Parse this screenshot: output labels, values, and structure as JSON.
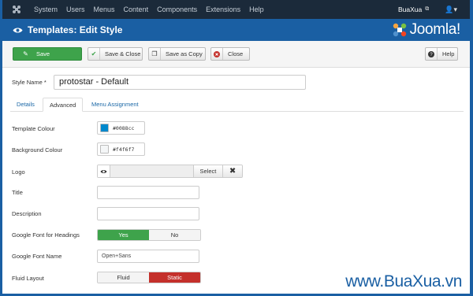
{
  "topbar": {
    "menu": [
      "System",
      "Users",
      "Menus",
      "Content",
      "Components",
      "Extensions",
      "Help"
    ],
    "user": "BuaXua"
  },
  "header": {
    "title": "Templates: Edit Style",
    "brand": "Joomla!"
  },
  "toolbar": {
    "save": "Save",
    "save_close": "Save & Close",
    "save_copy": "Save as Copy",
    "close": "Close",
    "help": "Help"
  },
  "style_name": {
    "label": "Style Name *",
    "value": "protostar - Default"
  },
  "tabs": [
    {
      "label": "Details",
      "active": false
    },
    {
      "label": "Advanced",
      "active": true
    },
    {
      "label": "Menu Assignment",
      "active": false
    }
  ],
  "form": {
    "template_colour": {
      "label": "Template Colour",
      "value": "#0088cc"
    },
    "background_colour": {
      "label": "Background Colour",
      "value": "#f4f6f7"
    },
    "logo": {
      "label": "Logo",
      "select": "Select",
      "clear": "✖"
    },
    "title": {
      "label": "Title",
      "value": ""
    },
    "description": {
      "label": "Description",
      "value": ""
    },
    "google_font_headings": {
      "label": "Google Font for Headings",
      "options": [
        "Yes",
        "No"
      ],
      "selected": "Yes"
    },
    "google_font_name": {
      "label": "Google Font Name",
      "value": "Open+Sans"
    },
    "fluid_layout": {
      "label": "Fluid Layout",
      "options": [
        "Fluid",
        "Static"
      ],
      "selected": "Static"
    }
  },
  "watermark": "www.BuaXua.vn",
  "colors": {
    "header_blue": "#1a5fa3",
    "topbar": "#1b2a3a",
    "save_green": "#3ea34b",
    "static_red": "#c4302b"
  }
}
